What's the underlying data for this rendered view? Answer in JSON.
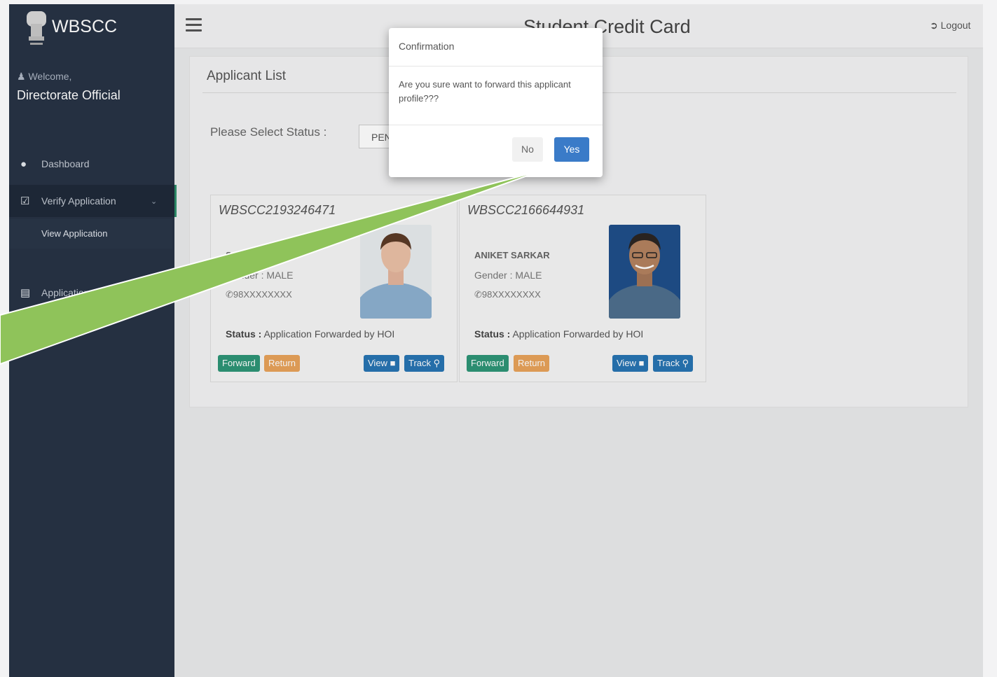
{
  "brand": "WBSCC",
  "sidebar": {
    "welcome": "Welcome,",
    "username": "Directorate Official",
    "items": [
      {
        "label": "Dashboard"
      },
      {
        "label": "Verify Application"
      },
      {
        "label": "View Application"
      },
      {
        "label": "Application Report"
      }
    ]
  },
  "header": {
    "title": "Student Credit Card",
    "logout": "Logout"
  },
  "main": {
    "title": "Applicant List",
    "status_label": "Please Select Status :",
    "status_value": "PENDING"
  },
  "cards": [
    {
      "id": "WBSCC2193246471",
      "name": "SANDIP DAS",
      "gender": "Gender   : MALE",
      "phone": "98XXXXXXXX",
      "status_label": "Status :",
      "status": "Application Forwarded by HOI",
      "forward": "Forward",
      "return": "Return",
      "view": "View",
      "track": "Track"
    },
    {
      "id": "WBSCC2166644931",
      "name": "ANIKET SARKAR",
      "gender": "Gender   : MALE",
      "phone": "98XXXXXXXX",
      "status_label": "Status :",
      "status": "Application Forwarded by HOI",
      "forward": "Forward",
      "return": "Return",
      "view": "View",
      "track": "Track"
    }
  ],
  "modal": {
    "title": "Confirmation",
    "message": "Are you sure want to forward this applicant profile???",
    "no": "No",
    "yes": "Yes"
  },
  "colors": {
    "sidebar_bg": "#273345",
    "forward_btn": "#2e9576",
    "return_btn": "#e8a35a",
    "view_btn": "#2874b3",
    "yes_btn": "#3a7bc8",
    "pointer_arrow": "#8fc35a"
  }
}
